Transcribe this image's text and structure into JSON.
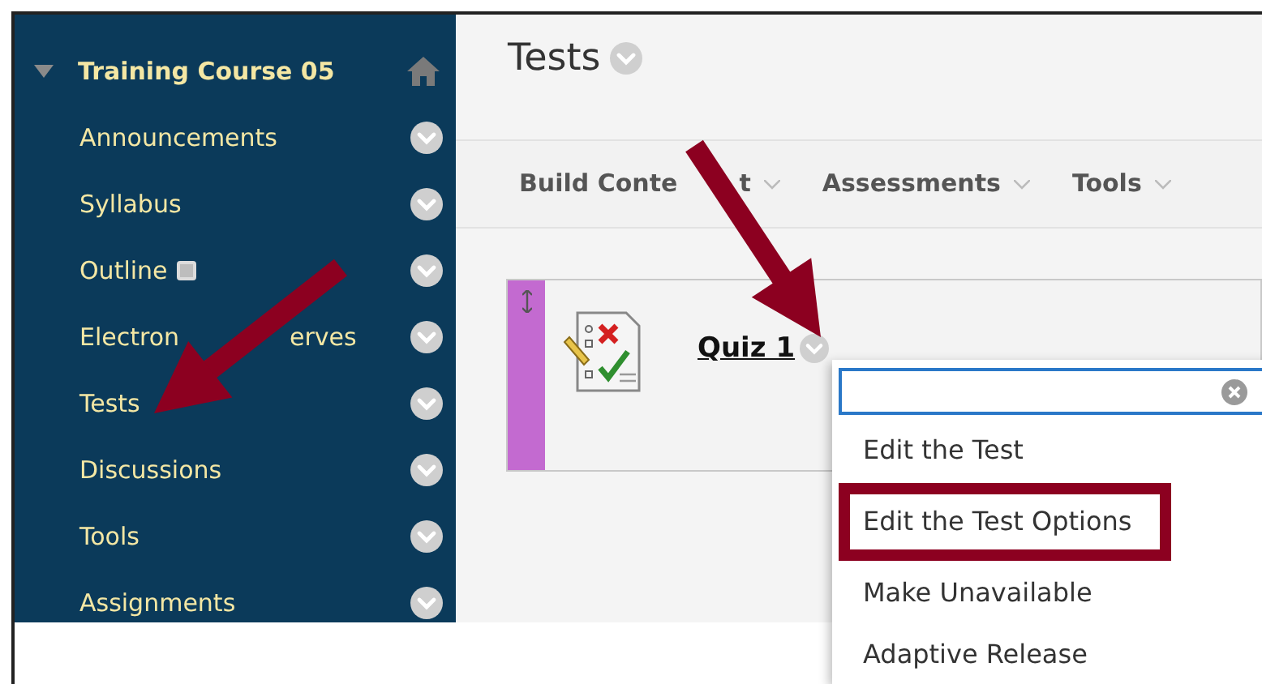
{
  "sidebar": {
    "course_title": "Training Course 05",
    "expanded": true,
    "items": [
      {
        "label": "Announcements",
        "has_badge": false
      },
      {
        "label": "Syllabus",
        "has_badge": false
      },
      {
        "label": "Outline",
        "has_badge": true
      },
      {
        "label_parts": [
          "Electron",
          "erves"
        ],
        "has_badge": false
      },
      {
        "label": "Tests",
        "has_badge": false
      },
      {
        "label": "Discussions",
        "has_badge": false
      },
      {
        "label": "Tools",
        "has_badge": false
      },
      {
        "label": "Assignments",
        "has_badge": false
      }
    ]
  },
  "page": {
    "title": "Tests"
  },
  "action_bar": [
    {
      "label_parts": [
        "Build Conte",
        "t"
      ]
    },
    {
      "label": "Assessments"
    },
    {
      "label": "Tools"
    }
  ],
  "content_item": {
    "title": "Quiz 1"
  },
  "context_menu": {
    "items": [
      {
        "label": "Edit the Test",
        "highlighted": false
      },
      {
        "label": "Edit the Test Options",
        "highlighted": true
      },
      {
        "label": "Make Unavailable",
        "highlighted": false
      },
      {
        "label": "Adaptive Release",
        "highlighted": false
      }
    ]
  }
}
